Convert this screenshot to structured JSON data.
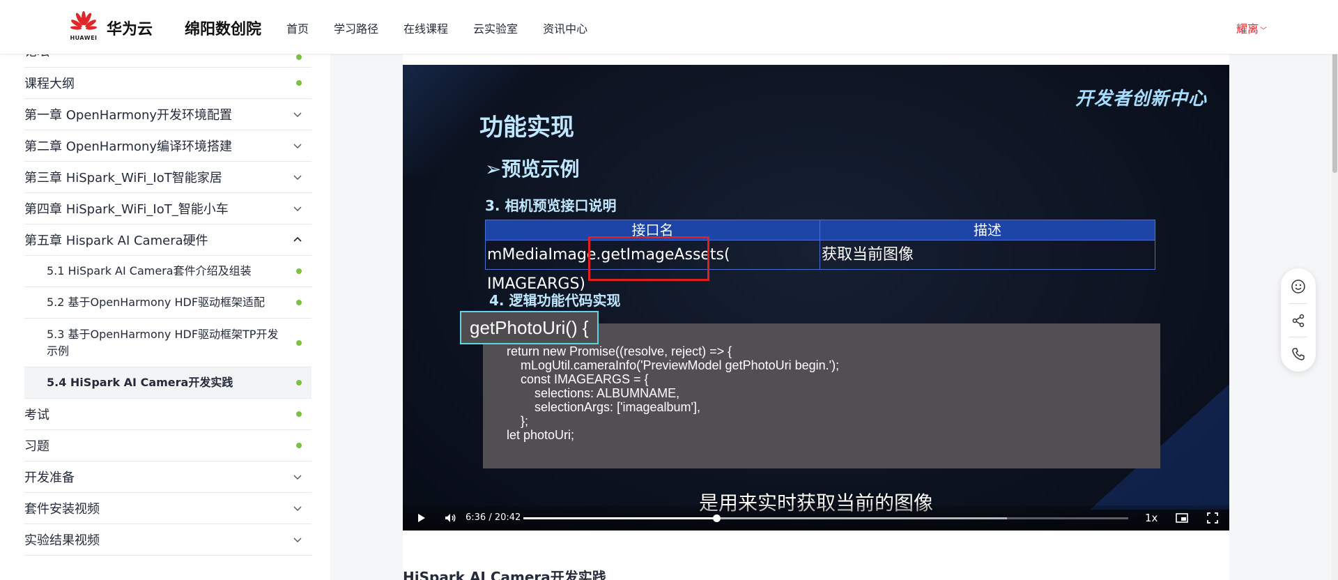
{
  "header": {
    "logo_text": "HUAWEI",
    "brand": "华为云",
    "site": "绵阳数创院",
    "nav": [
      "首页",
      "学习路径",
      "在线课程",
      "云实验室",
      "资讯中心"
    ],
    "user": "耀离"
  },
  "sidebar": {
    "partial_item": "论坛",
    "items": [
      {
        "label": "课程大纲",
        "type": "dot"
      },
      {
        "label": "第一章 OpenHarmony开发环境配置",
        "type": "chevron-down"
      },
      {
        "label": "第二章 OpenHarmony编译环境搭建",
        "type": "chevron-down"
      },
      {
        "label": "第三章 HiSpark_WiFi_IoT智能家居",
        "type": "chevron-down"
      },
      {
        "label": "第四章 HiSpark_WiFi_IoT_智能小车",
        "type": "chevron-down"
      },
      {
        "label": "第五章 Hispark AI Camera硬件",
        "type": "chevron-up"
      }
    ],
    "sub_items": [
      {
        "label": "5.1 HiSpark AI Camera套件介绍及组装"
      },
      {
        "label": "5.2 基于OpenHarmony HDF驱动框架适配"
      },
      {
        "label": "5.3 基于OpenHarmony HDF驱动框架TP开发示例"
      },
      {
        "label": "5.4 HiSpark AI Camera开发实践"
      }
    ],
    "bottom_items": [
      {
        "label": "考试",
        "type": "dot"
      },
      {
        "label": "习题",
        "type": "dot"
      },
      {
        "label": "开发准备",
        "type": "chevron-down"
      },
      {
        "label": "套件安装视频",
        "type": "chevron-down"
      },
      {
        "label": "实验结果视频",
        "type": "chevron-down"
      }
    ],
    "status_color": "#7cc242"
  },
  "video": {
    "brand": "开发者创新中心",
    "slide_title": "功能实现",
    "slide_sub": "➢预览示例",
    "section3": "3.  相机预览接口说明",
    "table_headers": [
      "接口名",
      "描述"
    ],
    "table_row": [
      "mMediaImage.getImageAssets( IMAGEARGS)",
      "获取当前图像"
    ],
    "section4": "4.  逻辑功能代码实现",
    "code_fn": "getPhotoUri() {",
    "code_lines": [
      "return new Promise((resolve, reject) => {",
      "    mLogUtil.cameraInfo('PreviewModel getPhotoUri begin.');",
      "    const IMAGEARGS = {",
      "        selections: ALBUMNAME,",
      "        selectionArgs: ['imagealbum'],",
      "    };",
      "let photoUri;"
    ],
    "caption": "是用来实时获取当前的图像",
    "time": "6:36 / 20:42",
    "progress_fraction": 0.3188,
    "buffered_fraction": 0.8,
    "speed": "1x"
  },
  "article_title": "HiSpark AI Camera开发实践"
}
